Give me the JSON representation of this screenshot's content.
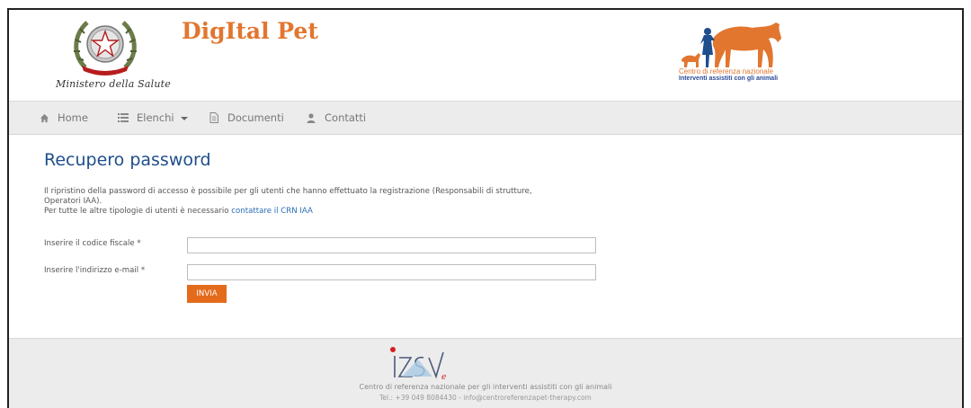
{
  "header": {
    "app_title": "DigItal Pet",
    "ministry": "Ministero della Salute",
    "crn_line1": "Centro di referenza nazionale",
    "crn_line2": "Interventi assistiti con gli animali"
  },
  "nav": {
    "items": [
      {
        "label": "Home",
        "icon": "home-icon"
      },
      {
        "label": "Elenchi",
        "icon": "list-icon"
      },
      {
        "label": "Documenti",
        "icon": "document-icon"
      },
      {
        "label": "Contatti",
        "icon": "user-icon"
      }
    ]
  },
  "main": {
    "title": "Recupero password",
    "info_line1": "Il ripristino della password di accesso è possibile per gli utenti che hanno effettuato la registrazione (Responsabili di strutture,",
    "info_line2": "Operatori IAA).",
    "info_line3_prefix": "Per tutte le altre tipologie di utenti è necessario ",
    "info_link": "contattare il CRN IAA",
    "codice_fiscale_label": "Inserire il codice fiscale *",
    "codice_fiscale_value": "",
    "email_label": "Inserire l'indirizzo e-mail *",
    "email_value": "",
    "submit_label": "INVIA"
  },
  "footer": {
    "line1": "Centro di referenza nazionale per gli interventi assistiti con gli animali",
    "line2": "Tel.: +39 049 8084430 - info@centroreferenzapet-therapy.com"
  },
  "colors": {
    "accent": "#e2762f",
    "title_blue": "#1f4e8c",
    "link_blue": "#2a6db5",
    "button": "#e46a1c"
  }
}
